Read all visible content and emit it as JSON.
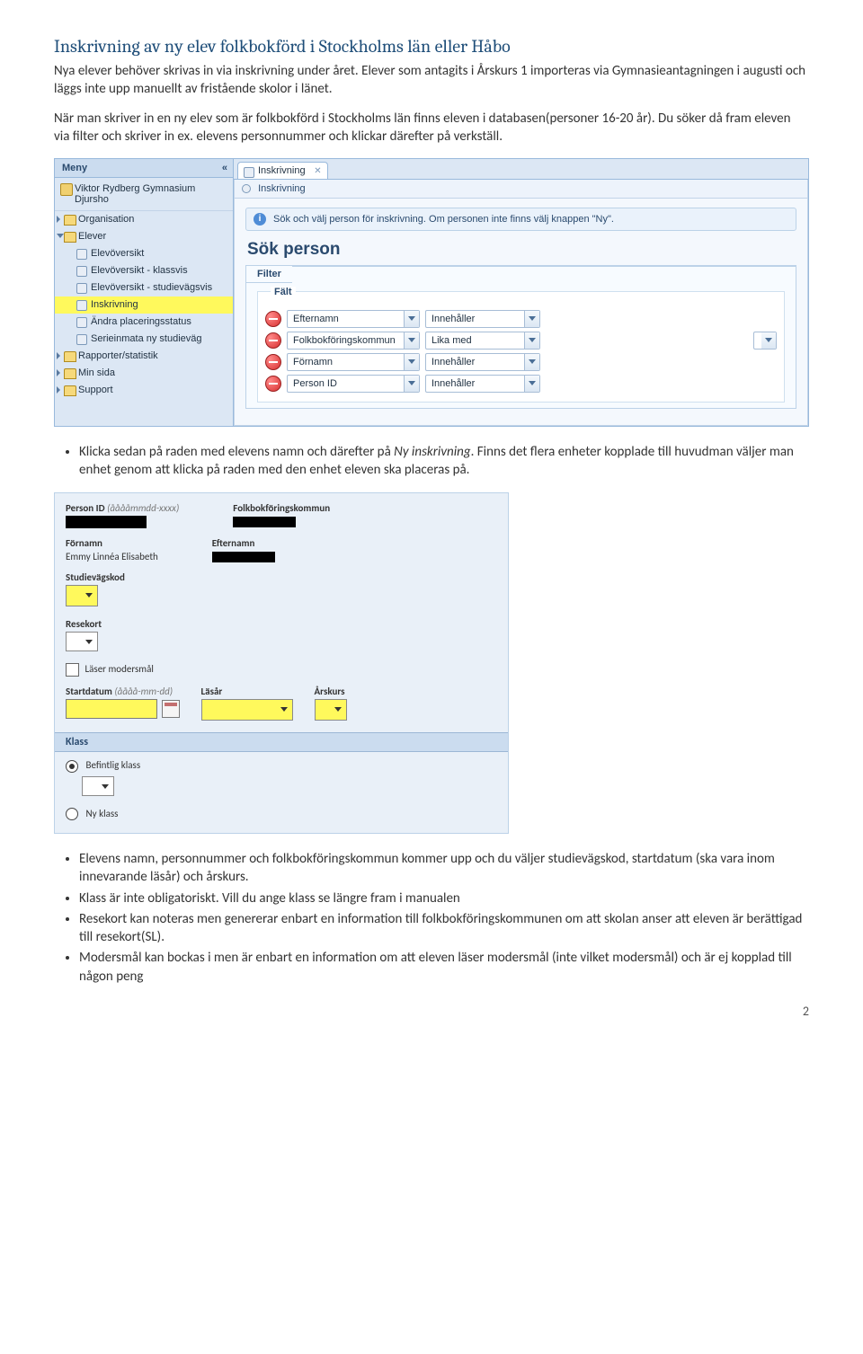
{
  "heading": "Inskrivning av ny elev folkbokförd i Stockholms län eller Håbo",
  "para1": "Nya elever behöver skrivas in via inskrivning under året. Elever som antagits i Årskurs 1 importeras via Gymnasieantagningen i augusti och läggs inte upp manuellt av fristående skolor i länet.",
  "para2": "När man skriver in en ny elev som är folkbokförd i Stockholms län finns eleven i databasen(personer 16-20 år). Du söker då fram eleven via filter och skriver in ex. elevens personnummer och klickar därefter på verkställ.",
  "screenshot1": {
    "meny_title": "Meny",
    "school": "Viktor Rydberg Gymnasium Djursho",
    "tree": [
      {
        "label": "Organisation",
        "type": "folder"
      },
      {
        "label": "Elever",
        "type": "folder_open",
        "children": [
          "Elevöversikt",
          "Elevöversikt - klassvis",
          "Elevöversikt - studievägsvis",
          "Inskrivning",
          "Ändra placeringsstatus",
          "Serieinmata ny studieväg"
        ]
      },
      {
        "label": "Rapporter/statistik",
        "type": "folder"
      },
      {
        "label": "Min sida",
        "type": "folder"
      },
      {
        "label": "Support",
        "type": "folder"
      }
    ],
    "tab_label": "Inskrivning",
    "panel_crumb": "Inskrivning",
    "info_text": "Sök och välj person för inskrivning. Om personen inte finns välj knappen \"Ny\".",
    "sok_title": "Sök person",
    "filter_title": "Filter",
    "falt_title": "Fält",
    "rows": [
      {
        "field": "Efternamn",
        "op": "Innehåller"
      },
      {
        "field": "Folkbokföringskommun",
        "op": "Lika med",
        "tail": true
      },
      {
        "field": "Förnamn",
        "op": "Innehåller"
      },
      {
        "field": "Person ID",
        "op": "Innehåller"
      }
    ]
  },
  "bullets_after_ss1": [
    {
      "pre": "Klicka sedan på raden med elevens namn och därefter på ",
      "italic": "Ny inskrivning",
      "post": ". Finns det flera enheter kopplade till huvudman väljer man enhet genom att klicka på raden med den enhet eleven ska placeras på."
    }
  ],
  "screenshot2": {
    "personid_label": "Person ID",
    "personid_hint": "(ååååmmdd-xxxx)",
    "folk_label": "Folkbokföringskommun",
    "fornamn_label": "Förnamn",
    "fornamn_value": "Emmy Linnéa Elisabeth",
    "efternamn_label": "Efternamn",
    "studiev_label": "Studievägskod",
    "resekort_label": "Resekort",
    "modersmal_label": "Läser modersmål",
    "startdatum_label": "Startdatum",
    "startdatum_hint": "(åååå-mm-dd)",
    "lasar_label": "Läsår",
    "arskurs_label": "Årskurs",
    "klass_label": "Klass",
    "befintlig": "Befintlig klass",
    "nyklass": "Ny klass"
  },
  "bullets_after_ss2": [
    "Elevens namn, personnummer och folkbokföringskommun kommer upp och du väljer studievägskod, startdatum (ska vara inom innevarande läsår) och årskurs.",
    "Klass är inte obligatoriskt. Vill du ange klass se längre fram i manualen",
    "Resekort kan noteras men genererar enbart en information till folkbokföringskommunen om att skolan anser att eleven är berättigad till resekort(SL).",
    "Modersmål kan bockas i men är enbart en information om att eleven läser modersmål (inte vilket modersmål) och är ej kopplad till någon peng"
  ],
  "page_number": "2"
}
